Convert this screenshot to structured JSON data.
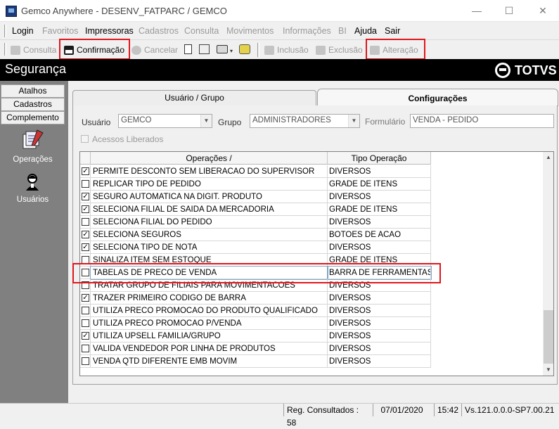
{
  "window": {
    "title": "Gemco Anywhere - DESENV_FATPARC / GEMCO",
    "minimize": "—",
    "maximize": "☐",
    "close": "✕"
  },
  "menu": {
    "items": [
      {
        "label": "Login",
        "enabled": true
      },
      {
        "label": "Favoritos",
        "enabled": false
      },
      {
        "label": "Impressoras",
        "enabled": true
      },
      {
        "label": "Cadastros",
        "enabled": false
      },
      {
        "label": "Consulta",
        "enabled": false
      },
      {
        "label": "Movimentos",
        "enabled": false
      },
      {
        "label": "Informações",
        "enabled": false
      },
      {
        "label": "BI",
        "enabled": false
      },
      {
        "label": "Ajuda",
        "enabled": true
      },
      {
        "label": "Sair",
        "enabled": true
      }
    ]
  },
  "toolbar": {
    "consulta": "Consulta",
    "confirmacao": "Confirmação",
    "cancelar": "Cancelar",
    "inclusao": "Inclusão",
    "exclusao": "Exclusão",
    "alteracao": "Alteração"
  },
  "header": {
    "title": "Segurança",
    "brand": "TOTVS"
  },
  "sidebar": {
    "tabs": [
      "Atalhos",
      "Cadastros",
      "Complemento"
    ],
    "items": [
      {
        "label": "Operações",
        "icon": "operations-icon"
      },
      {
        "label": "Usuários",
        "icon": "users-icon"
      }
    ]
  },
  "tabs": {
    "usuario_grupo": "Usuário  / Grupo",
    "configuracoes": "Configurações"
  },
  "form": {
    "usuario_label": "Usuário",
    "usuario_value": "GEMCO",
    "grupo_label": "Grupo",
    "grupo_value": "ADMINISTRADORES",
    "formulario_label": "Formulário",
    "formulario_value": "VENDA - PEDIDO",
    "acessos_label": "Acessos Liberados"
  },
  "grid": {
    "columns": [
      "Operações  /",
      "Tipo Operação"
    ],
    "rows": [
      {
        "checked": true,
        "operacao": "PERMITE DESCONTO SEM LIBERACAO DO SUPERVISOR",
        "tipo": "DIVERSOS"
      },
      {
        "checked": false,
        "operacao": "REPLICAR TIPO DE PEDIDO",
        "tipo": "GRADE DE ITENS"
      },
      {
        "checked": true,
        "operacao": "SEGURO AUTOMATICA NA DIGIT. PRODUTO",
        "tipo": "DIVERSOS"
      },
      {
        "checked": true,
        "operacao": "SELECIONA FILIAL DE SAIDA DA MERCADORIA",
        "tipo": "GRADE DE ITENS"
      },
      {
        "checked": false,
        "operacao": "SELECIONA FILIAL DO PEDIDO",
        "tipo": "DIVERSOS"
      },
      {
        "checked": true,
        "operacao": "SELECIONA SEGUROS",
        "tipo": "BOTOES DE ACAO"
      },
      {
        "checked": true,
        "operacao": "SELECIONA TIPO DE NOTA",
        "tipo": "DIVERSOS"
      },
      {
        "checked": false,
        "operacao": "SINALIZA ITEM SEM ESTOQUE",
        "tipo": "GRADE DE ITENS"
      },
      {
        "checked": false,
        "operacao": "TABELAS DE PRECO DE VENDA",
        "tipo": "BARRA DE FERRAMENTAS"
      },
      {
        "checked": false,
        "operacao": "TRATAR GRUPO DE FILIAIS PARA MOVIMENTACOES",
        "tipo": "DIVERSOS"
      },
      {
        "checked": true,
        "operacao": "TRAZER PRIMEIRO CODIGO DE BARRA",
        "tipo": "DIVERSOS"
      },
      {
        "checked": false,
        "operacao": "UTILIZA PRECO PROMOCAO DO PRODUTO QUALIFICADO",
        "tipo": "DIVERSOS"
      },
      {
        "checked": false,
        "operacao": "UTILIZA PRECO PROMOCAO P/VENDA",
        "tipo": "DIVERSOS"
      },
      {
        "checked": true,
        "operacao": "UTILIZA UPSELL FAMILIA/GRUPO",
        "tipo": "DIVERSOS"
      },
      {
        "checked": false,
        "operacao": "VALIDA VENDEDOR POR LINHA DE PRODUTOS",
        "tipo": "DIVERSOS"
      },
      {
        "checked": false,
        "operacao": "VENDA QTD DIFERENTE EMB MOVIM",
        "tipo": "DIVERSOS"
      }
    ]
  },
  "status": {
    "registros": "Reg. Consultados : 58",
    "data": "07/01/2020",
    "hora": "15:42",
    "versao": "Vs.121.0.0.0-SP7.00.21"
  },
  "colors": {
    "highlight": "#e0161c",
    "header_bg": "#000000",
    "sidebar_bg": "#808080"
  }
}
